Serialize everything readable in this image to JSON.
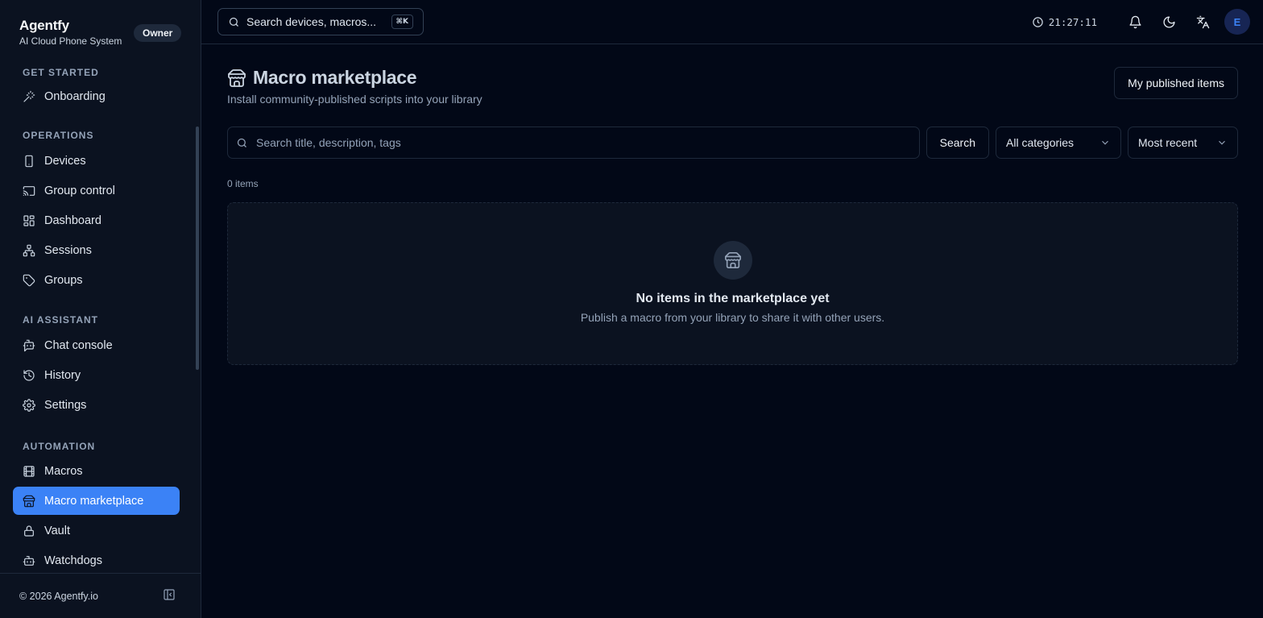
{
  "brand": {
    "name": "Agentfy",
    "subtitle": "AI Cloud Phone System",
    "role_badge": "Owner"
  },
  "sidebar": {
    "sections": [
      {
        "title": "GET STARTED",
        "items": [
          {
            "label": "Onboarding",
            "icon": "wand-icon"
          }
        ]
      },
      {
        "title": "OPERATIONS",
        "items": [
          {
            "label": "Devices",
            "icon": "smartphone-icon"
          },
          {
            "label": "Group control",
            "icon": "cast-icon"
          },
          {
            "label": "Dashboard",
            "icon": "dashboard-icon"
          },
          {
            "label": "Sessions",
            "icon": "network-icon"
          },
          {
            "label": "Groups",
            "icon": "tag-icon"
          }
        ]
      },
      {
        "title": "AI ASSISTANT",
        "items": [
          {
            "label": "Chat console",
            "icon": "bot-chat-icon"
          },
          {
            "label": "History",
            "icon": "history-icon"
          },
          {
            "label": "Settings",
            "icon": "gear-icon"
          }
        ]
      },
      {
        "title": "AUTOMATION",
        "items": [
          {
            "label": "Macros",
            "icon": "film-icon"
          },
          {
            "label": "Macro marketplace",
            "icon": "store-icon",
            "active": true
          },
          {
            "label": "Vault",
            "icon": "lock-icon"
          },
          {
            "label": "Watchdogs",
            "icon": "bot-icon"
          }
        ]
      }
    ],
    "footer": {
      "copyright": "© 2026 Agentfy.io"
    }
  },
  "topbar": {
    "search_placeholder": "Search devices, macros...",
    "shortcut": "⌘K",
    "clock": "21:27:11",
    "avatar_initial": "E"
  },
  "page": {
    "title": "Macro marketplace",
    "subtitle": "Install community-published scripts into your library",
    "published_button": "My published items",
    "search": {
      "placeholder": "Search title, description, tags",
      "value": ""
    },
    "search_button": "Search",
    "category_select": "All categories",
    "sort_select": "Most recent",
    "item_count": "0 items",
    "empty_state": {
      "title": "No items in the marketplace yet",
      "text": "Publish a macro from your library to share it with other users."
    }
  },
  "colors": {
    "accent": "#3b82f6",
    "background": "#020817",
    "sidebar": "#0b1220"
  }
}
